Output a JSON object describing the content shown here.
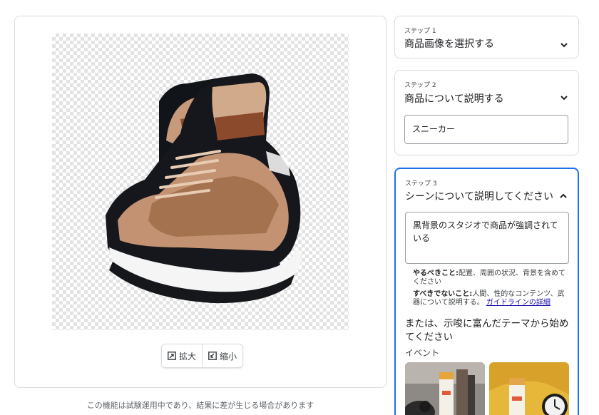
{
  "preview": {
    "zoom_in_label": "拡大",
    "zoom_out_label": "縮小",
    "disclaimer": "この機能は試験運用中であり、結果に差が生じる場合があります"
  },
  "steps": [
    {
      "kicker": "ステップ 1",
      "title": "商品画像を選択する",
      "expanded": false
    },
    {
      "kicker": "ステップ 2",
      "title": "商品について説明する",
      "expanded": true,
      "input_value": "スニーカー"
    },
    {
      "kicker": "ステップ 3",
      "title": "シーンについて説明してください",
      "expanded": true,
      "input_value": "黒背景のスタジオで商品が強調されている",
      "do_label": "やるべきこと:",
      "do_text": "配置、周囲の状況、背景を含めてください",
      "dont_label": "すべきでないこと:",
      "dont_text": "人間、性的なコンテンツ、武器について説明する。",
      "guideline_link": "ガイドラインの詳細",
      "theme_lead": "または、示唆に富んだテーマから始めてください",
      "theme_category": "イベント"
    }
  ],
  "colors": {
    "accent": "#1a73e8",
    "border": "#dadce0",
    "link": "#1a0dab"
  },
  "icons": [
    "zoom-in-icon",
    "zoom-out-icon",
    "chevron-down-icon",
    "chevron-up-icon"
  ]
}
